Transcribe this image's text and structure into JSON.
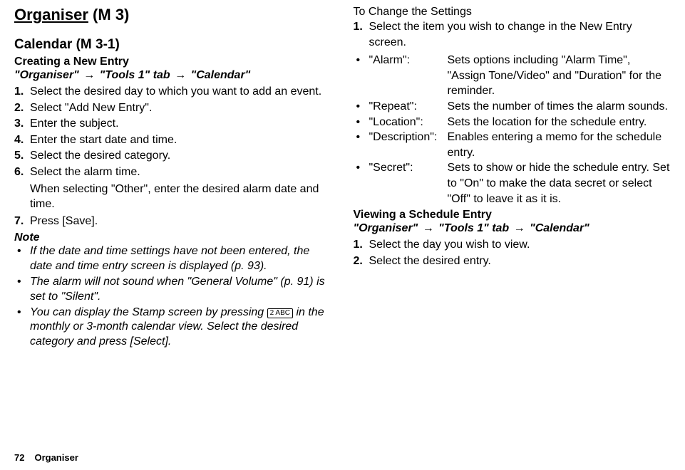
{
  "heading": {
    "title_underline": "Organiser",
    "title_suffix": " (M 3)"
  },
  "calendar": {
    "heading": "Calendar (M 3-1)",
    "creating": {
      "title": "Creating a New Entry",
      "nav1": "\"Organiser\"",
      "nav2": "\"Tools 1\" tab",
      "nav3": "\"Calendar\"",
      "steps": [
        "Select the desired day to which you want to add an event.",
        "Select \"Add New Entry\".",
        "Enter the subject.",
        "Enter the start date and time.",
        "Select the desired category.",
        "Select the alarm time.",
        "Press [Save]."
      ],
      "step6_note": "When selecting \"Other\", enter the desired alarm date and time."
    },
    "note_label": "Note",
    "notes": {
      "n1": "If the date and time settings have not been entered, the date and time entry screen is displayed (p. 93).",
      "n2": "The alarm will not sound when \"General Volume\" (p. 91) is set to \"Silent\".",
      "n3a": "You can display the Stamp screen by pressing ",
      "n3b": " in the monthly or 3-month calendar view. Select the desired category and press [Select]."
    },
    "key_label": "2 ABC"
  },
  "right": {
    "change_title": "To Change the Settings",
    "change_step1": "Select the item you wish to change in the New Entry screen.",
    "settings": [
      {
        "term": "\"Alarm\":",
        "desc": "Sets options including \"Alarm Time\", \"Assign Tone/Video\" and \"Duration\" for the reminder."
      },
      {
        "term": "\"Repeat\":",
        "desc": "Sets the number of times the alarm sounds."
      },
      {
        "term": "\"Location\":",
        "desc": "Sets the location for the schedule entry."
      },
      {
        "term": "\"Description\":",
        "desc": "Enables entering a memo for the schedule entry."
      },
      {
        "term": "\"Secret\":",
        "desc": "Sets to show or hide the schedule entry. Set to \"On\" to make the data secret or select \"Off\" to leave it as it is."
      }
    ],
    "viewing": {
      "title": "Viewing a Schedule Entry",
      "nav1": "\"Organiser\"",
      "nav2": "\"Tools 1\" tab",
      "nav3": "\"Calendar\"",
      "steps": [
        "Select the day you wish to view.",
        "Select the desired entry."
      ]
    }
  },
  "footer": {
    "page": "72",
    "section": "Organiser"
  }
}
